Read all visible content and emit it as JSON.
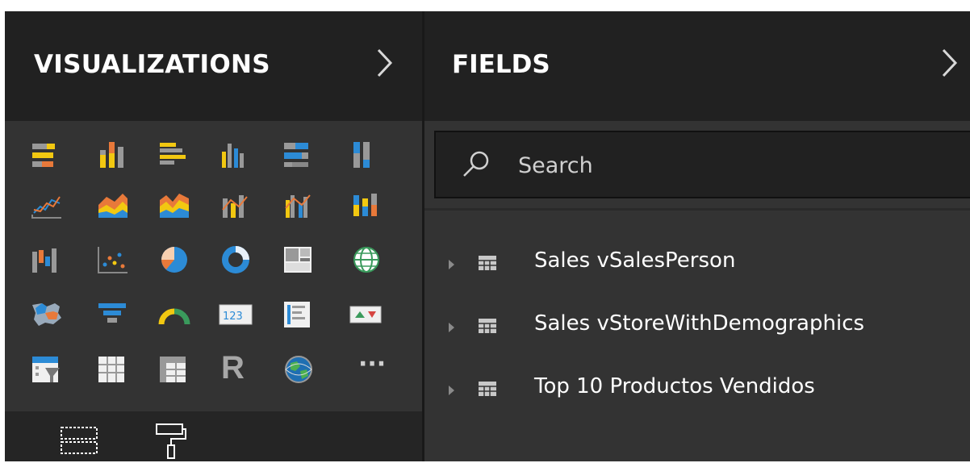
{
  "visualizations": {
    "title": "VISUALIZATIONS",
    "collapse_icon": "chevron-right-icon",
    "icons": [
      [
        "stacked-bar-chart-icon",
        "stacked-column-chart-icon",
        "clustered-bar-chart-icon",
        "clustered-column-chart-icon",
        "100-stacked-bar-chart-icon",
        "100-stacked-column-chart-icon"
      ],
      [
        "line-chart-icon",
        "area-chart-icon",
        "stacked-area-chart-icon",
        "line-and-stacked-column-chart-icon",
        "line-and-clustered-column-chart-icon",
        "ribbon-chart-icon"
      ],
      [
        "waterfall-chart-icon",
        "scatter-chart-icon",
        "pie-chart-icon",
        "donut-chart-icon",
        "treemap-icon",
        "map-icon"
      ],
      [
        "filled-map-icon",
        "funnel-icon",
        "gauge-icon",
        "card-icon",
        "multi-row-card-icon",
        "kpi-icon"
      ],
      [
        "slicer-icon",
        "table-icon",
        "matrix-icon",
        "r-visual-icon",
        "globe-map-icon",
        "more-icon"
      ]
    ],
    "r_label": "R",
    "more_label": "···",
    "bottom_tabs": [
      "fields-well-icon",
      "format-paint-roller-icon"
    ]
  },
  "fields": {
    "title": "FIELDS",
    "collapse_icon": "chevron-right-icon",
    "search": {
      "icon": "search-icon",
      "placeholder": "Search"
    },
    "tables": [
      {
        "label": "Sales vSalesPerson",
        "icon": "table-icon"
      },
      {
        "label": "Sales vStoreWithDemographics",
        "icon": "table-icon"
      },
      {
        "label": "Top 10 Productos Vendidos",
        "icon": "table-icon"
      }
    ]
  },
  "colors": {
    "header_bg": "#212121",
    "pane_bg": "#333333",
    "accent_yellow": "#f2c811",
    "accent_orange": "#e8793a",
    "accent_blue": "#2c8bd6",
    "gray": "#999999"
  }
}
